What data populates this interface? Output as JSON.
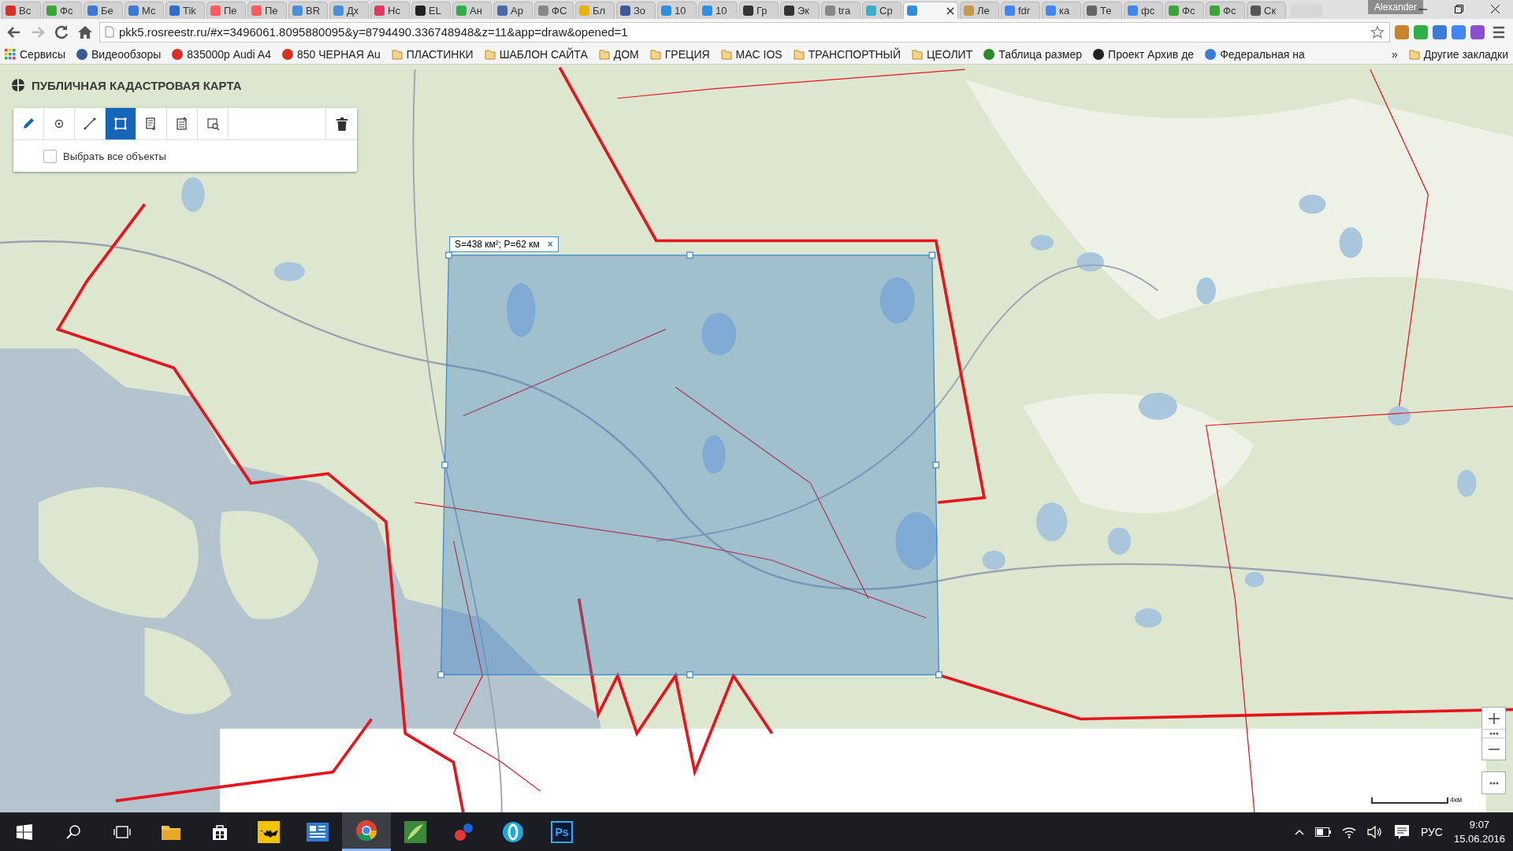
{
  "browser": {
    "profile": "Alexander",
    "tabs": [
      {
        "title": "Вс",
        "color": "#d93025",
        "selected": false
      },
      {
        "title": "Фс",
        "color": "#3aa63a",
        "selected": false
      },
      {
        "title": "Бе",
        "color": "#3a7bd5",
        "selected": false
      },
      {
        "title": "Мс",
        "color": "#3a7bd5",
        "selected": false
      },
      {
        "title": "Tik",
        "color": "#2f6fd0",
        "selected": false
      },
      {
        "title": "Пе",
        "color": "#ff5a5f",
        "selected": false
      },
      {
        "title": "Пе",
        "color": "#ff5a5f",
        "selected": false
      },
      {
        "title": "BR",
        "color": "#4a90d9",
        "selected": false
      },
      {
        "title": "Дх",
        "color": "#4a90d9",
        "selected": false
      },
      {
        "title": "Нс",
        "color": "#e03a5f",
        "selected": false
      },
      {
        "title": "EL",
        "color": "#222222",
        "selected": false
      },
      {
        "title": "Ан",
        "color": "#2fae4a",
        "selected": false
      },
      {
        "title": "Ар",
        "color": "#4a6aa8",
        "selected": false
      },
      {
        "title": "ФС",
        "color": "#888888",
        "selected": false
      },
      {
        "title": "Бл",
        "color": "#e8b400",
        "selected": false
      },
      {
        "title": "Зо",
        "color": "#3a5a9a",
        "selected": false
      },
      {
        "title": "10",
        "color": "#2d8fe0",
        "selected": false
      },
      {
        "title": "10",
        "color": "#2d8fe0",
        "selected": false
      },
      {
        "title": "Гр",
        "color": "#333333",
        "selected": false
      },
      {
        "title": "Эк",
        "color": "#333333",
        "selected": false
      },
      {
        "title": "tra",
        "color": "#888888",
        "selected": false
      },
      {
        "title": "Ср",
        "color": "#35b0c8",
        "selected": false
      },
      {
        "color": "#2d8fe0",
        "selected": true
      },
      {
        "title": "Ле",
        "color": "#c89a50",
        "selected": false
      },
      {
        "title": "fdr",
        "color": "#4285f4",
        "selected": false
      },
      {
        "title": "ка",
        "color": "#4285f4",
        "selected": false
      },
      {
        "title": "Те",
        "color": "#666666",
        "selected": false
      },
      {
        "title": "фс",
        "color": "#4285f4",
        "selected": false
      },
      {
        "title": "Фс",
        "color": "#3aa63a",
        "selected": false
      },
      {
        "title": "Фс",
        "color": "#3aa63a",
        "selected": false
      },
      {
        "title": "Ск",
        "color": "#555555",
        "selected": false
      }
    ],
    "address": "pkk5.rosreestr.ru/#x=3496061.8095880095&y=8794490.336748948&z=11&app=draw&opened=1",
    "extensions": [
      {
        "color": "#c8842a"
      },
      {
        "color": "#2fae4a"
      },
      {
        "color": "#3a7bd5"
      },
      {
        "color": "#4285f4"
      },
      {
        "color": "#8a4fd0"
      }
    ],
    "bookmarks": [
      {
        "kind": "apps",
        "title": "Сервисы"
      },
      {
        "kind": "site",
        "title": "Видеообзоры",
        "color": "#3a5a9a"
      },
      {
        "kind": "site",
        "title": "835000р Audi A4",
        "color": "#d93025"
      },
      {
        "kind": "site",
        "title": "850 ЧЕРНАЯ Au",
        "color": "#d93025"
      },
      {
        "kind": "folder",
        "title": "ПЛАСТИНКИ"
      },
      {
        "kind": "folder",
        "title": "ШАБЛОН САЙТА"
      },
      {
        "kind": "folder",
        "title": "ДОМ"
      },
      {
        "kind": "folder",
        "title": "ГРЕЦИЯ"
      },
      {
        "kind": "folder",
        "title": "MAC IOS"
      },
      {
        "kind": "folder",
        "title": "ТРАНСПОРТНЫЙ"
      },
      {
        "kind": "folder",
        "title": "ЦЕОЛИТ"
      },
      {
        "kind": "site",
        "title": "Таблица размер",
        "color": "#2a8a2a"
      },
      {
        "kind": "site",
        "title": "Проект Архив де",
        "color": "#222222"
      },
      {
        "kind": "site",
        "title": "Федеральная на",
        "color": "#3a7bd5"
      }
    ],
    "more_bookmarks": "»",
    "other_bookmarks": "Другие закладки"
  },
  "map": {
    "title": "ПУБЛИЧНАЯ КАДАСТРОВАЯ КАРТА",
    "tools": [
      {
        "kind": "pencil",
        "selected": false
      },
      {
        "kind": "point",
        "selected": false
      },
      {
        "kind": "line",
        "selected": false
      },
      {
        "kind": "rectangle",
        "selected": true
      },
      {
        "kind": "import",
        "selected": false
      },
      {
        "kind": "export",
        "selected": false
      },
      {
        "kind": "select-area",
        "selected": false
      }
    ],
    "select_all": {
      "label": "Выбрать все объекты",
      "checked": false
    },
    "measurement": {
      "text": "S=438 км²; P=62 км",
      "close": "×"
    },
    "scale": "4км"
  },
  "taskbar": {
    "apps": [
      {
        "kind": "explorer",
        "active": false
      },
      {
        "kind": "store",
        "active": false
      },
      {
        "kind": "batman",
        "active": false
      },
      {
        "kind": "news",
        "active": false
      },
      {
        "kind": "chrome",
        "active": true
      },
      {
        "kind": "green",
        "active": false
      },
      {
        "kind": "dots",
        "active": false
      },
      {
        "kind": "opera",
        "active": false
      },
      {
        "kind": "photoshop",
        "label": "Ps",
        "active": false
      }
    ],
    "language": "РУС",
    "time": "9:07",
    "date": "15.06.2016"
  }
}
